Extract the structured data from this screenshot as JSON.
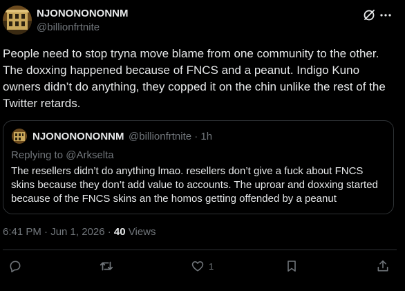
{
  "tweet": {
    "author_name": "NJONONONONNM",
    "author_handle": "@billionfrtnite",
    "text": "People need to stop tryna move blame from one community to the other. The doxxing happened because of FNCS and a peanut. Indigo Kuno owners didn’t do anything, they copped it on the chin unlike the rest of the Twitter retards.",
    "timestamp": "6:41 PM · Jun 1, 2026 · ",
    "views_count": "40",
    "views_label": " Views"
  },
  "quote": {
    "author_name": "NJONONONONNM",
    "meta": "@billionfrtnite · 1h",
    "replying_prefix": "Replying to ",
    "replying_handle": "@Arkselta",
    "text": "The resellers didn’t do anything lmao. resellers don’t give a fuck about FNCS skins because they don’t add value to accounts. The uproar and doxxing started because of the FNCS skins an the homos getting offended by a peanut"
  },
  "actions": {
    "likes": "1"
  },
  "icons": {
    "header": [
      "grok-icon",
      "more-icon"
    ],
    "actions": [
      "reply-icon",
      "repost-icon",
      "like-icon",
      "bookmark-icon",
      "share-icon"
    ]
  },
  "colors": {
    "background": "#000000",
    "text": "#e7e9ea",
    "muted": "#71767b",
    "border": "#2f3336"
  }
}
